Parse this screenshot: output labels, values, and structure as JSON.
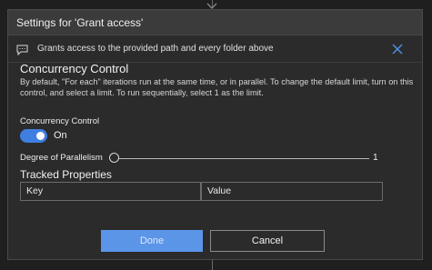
{
  "dialog": {
    "title": "Settings for 'Grant access'",
    "description": "Grants access to the provided path and every folder above"
  },
  "concurrency": {
    "section_title": "Concurrency Control",
    "section_description": "By default, \"For each\" iterations run at the same time, or in parallel. To change the default limit, turn on this control, and select a limit. To run sequentially, select 1 as the limit.",
    "toggle_label": "Concurrency Control",
    "toggle_state": "On",
    "toggle_on": true,
    "parallelism_label": "Degree of Parallelism",
    "parallelism_value": "1"
  },
  "tracked": {
    "title": "Tracked Properties",
    "key_placeholder": "Key",
    "value_placeholder": "Value"
  },
  "buttons": {
    "done_label": "Done",
    "cancel_label": "Cancel"
  },
  "icons": {
    "comment": "comment-icon",
    "close": "close-icon",
    "connector_arrow": "arrow-down-icon"
  },
  "colors": {
    "accent": "#3f7fe0",
    "done_button": "#5a95e8",
    "close_icon": "#4a90e2"
  }
}
